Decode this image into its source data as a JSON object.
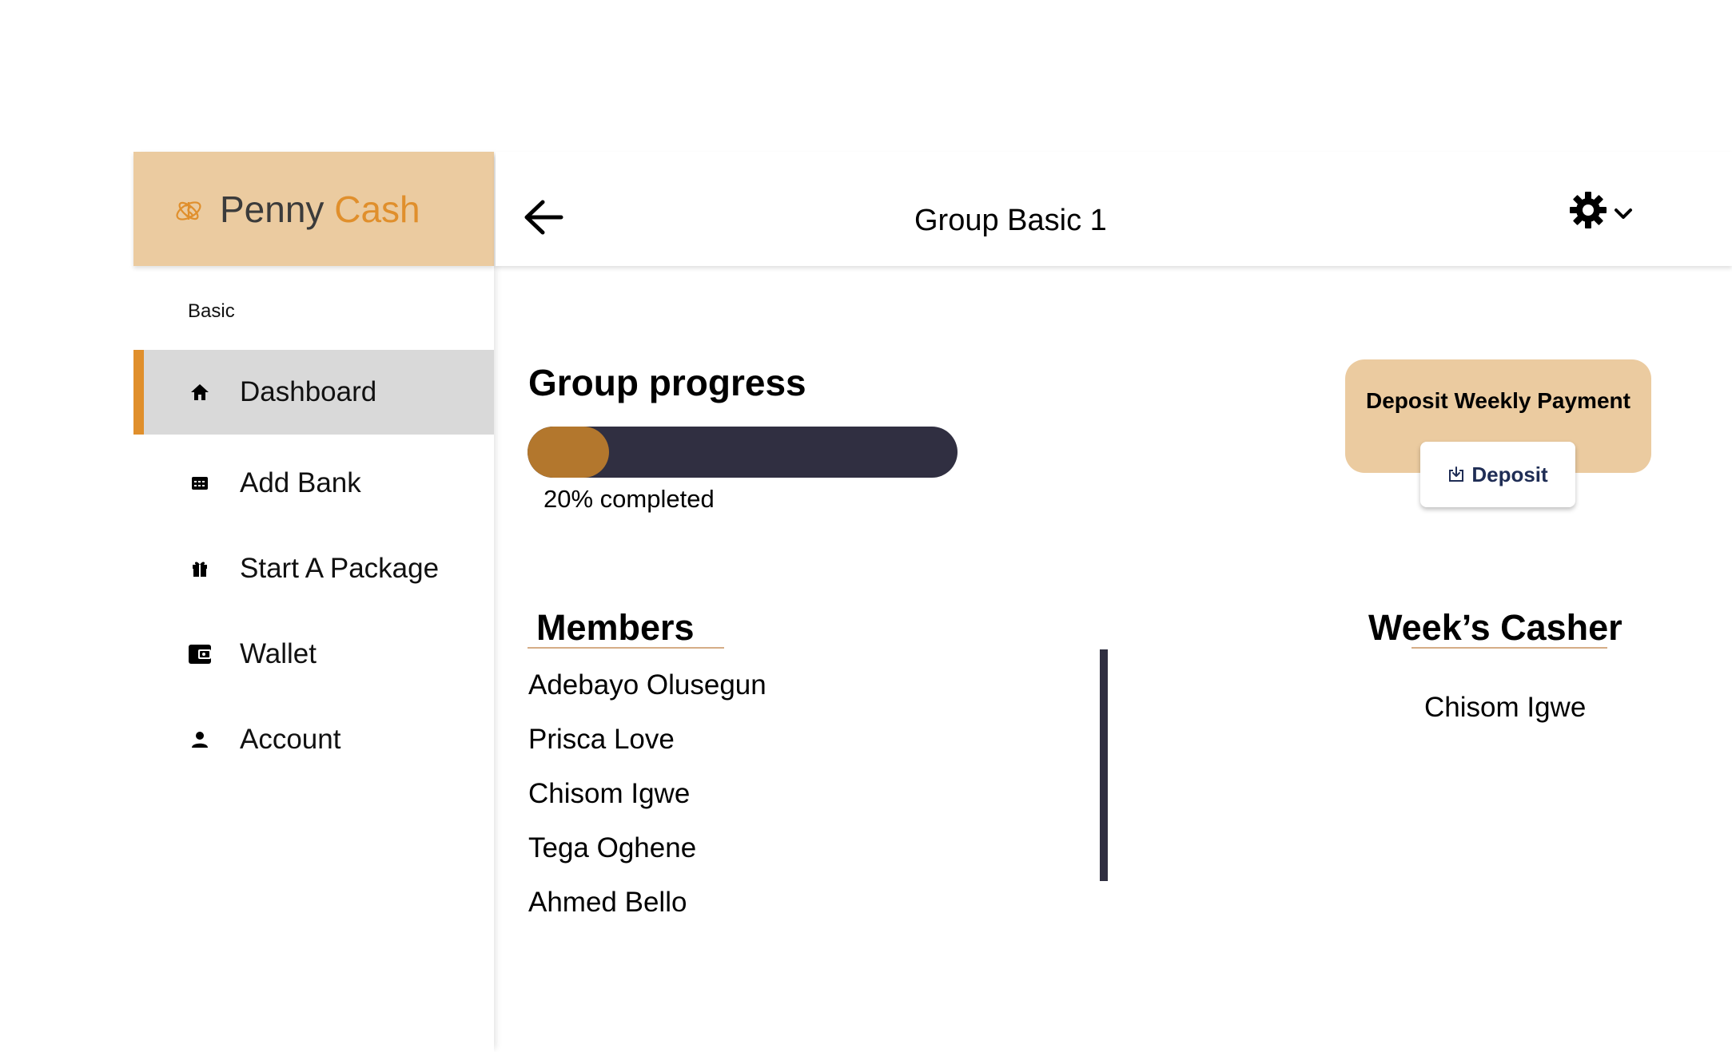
{
  "brand": {
    "name_part1": "Penny",
    "name_part2": "Cash",
    "accent_color": "#e08f2c",
    "header_bg": "#ebcba0",
    "logo_icon": "cash-swirl-icon"
  },
  "sidebar": {
    "section_label": "Basic",
    "items": [
      {
        "label": "Dashboard",
        "icon": "home-icon",
        "active": true
      },
      {
        "label": "Add Bank",
        "icon": "bank-card-icon",
        "active": false
      },
      {
        "label": "Start A Package",
        "icon": "gift-icon",
        "active": false
      },
      {
        "label": "Wallet",
        "icon": "wallet-icon",
        "active": false
      },
      {
        "label": "Account",
        "icon": "person-icon",
        "active": false
      }
    ]
  },
  "header": {
    "title": "Group Basic 1",
    "back_icon": "arrow-left-icon",
    "settings_icon": "gear-icon",
    "dropdown_icon": "chevron-down-icon"
  },
  "progress": {
    "title": "Group progress",
    "value": 0.2,
    "label": "20% completed",
    "fill_color": "#b3772d",
    "track_color": "#302f41"
  },
  "members": {
    "title": "Members",
    "list": [
      "Adebayo Olusegun",
      "Prisca Love",
      "Chisom Igwe",
      "Tega Oghene",
      "Ahmed Bello"
    ]
  },
  "deposit": {
    "card_title": "Deposit Weekly Payment",
    "button_label": "Deposit",
    "button_icon": "download-box-icon"
  },
  "casher": {
    "title": "Week’s Casher",
    "name": "Chisom Igwe"
  }
}
